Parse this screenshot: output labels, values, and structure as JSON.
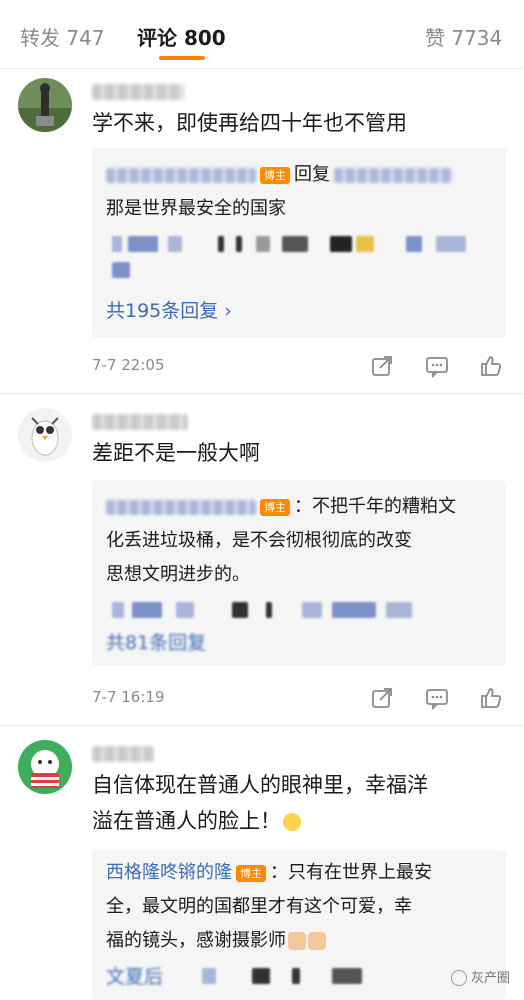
{
  "tabs": [
    {
      "label": "转发 747",
      "active": false
    },
    {
      "label": "评论 800",
      "active": true
    },
    {
      "label": "赞 7734",
      "active": false
    }
  ],
  "accent_color": "#ff8200",
  "link_color": "#3d6bb6",
  "comments": [
    {
      "text": "学不来，即使再给四十年也不管用",
      "reply": {
        "badge": "博主",
        "prefix": "回复",
        "text": "那是世界最安全的国家",
        "more": "共195条回复 ›"
      },
      "time": "7-7 22:05"
    },
    {
      "text": "差距不是一般大啊",
      "reply": {
        "badge": "博主",
        "line1": "：不把千年的糟粕文",
        "line2": "化丢进垃圾桶，是不会彻根彻底的改变",
        "line3": "思想文明进步的。",
        "more": "共81条回复"
      },
      "time": "7-7 16:19"
    },
    {
      "text_line1": "自信体现在普通人的眼神里，幸福洋",
      "text_line2": "溢在普通人的脸上！",
      "reply": {
        "name": "西格隆咚锵的隆",
        "badge": "博主",
        "line1": "：只有在世界上最安",
        "line2": "全，最文明的国都里才有这个可爱，幸",
        "line3": "福的镜头，感谢摄影师",
        "more": "文夏后"
      }
    }
  ],
  "icons": [
    "share-icon",
    "comment-icon",
    "like-icon"
  ],
  "watermark": "灰产圈"
}
